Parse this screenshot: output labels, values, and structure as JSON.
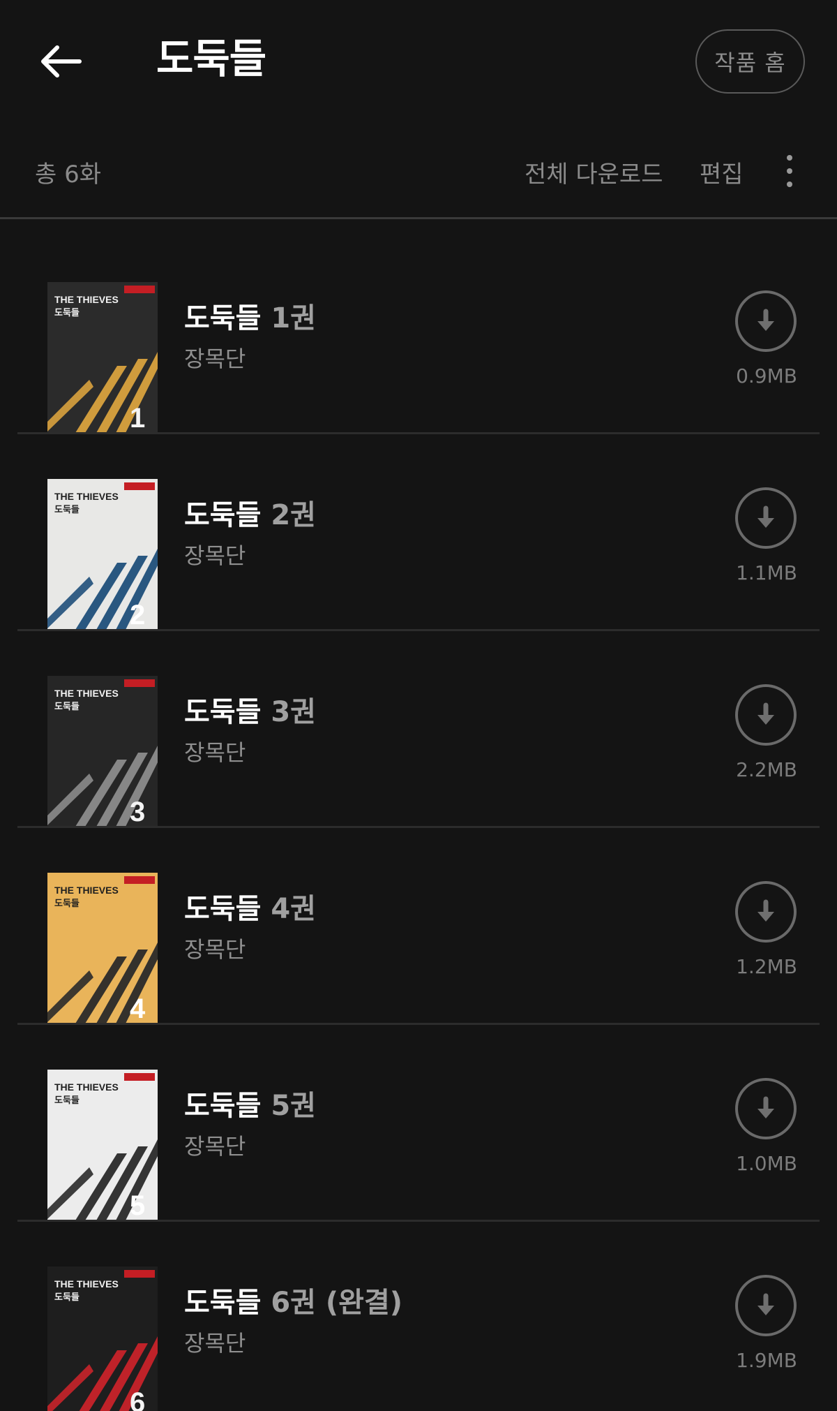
{
  "header": {
    "title": "도둑들",
    "home_button": "작품 홈",
    "back_icon": "arrow-left-icon"
  },
  "toolbar": {
    "total_count": "총 6화",
    "download_all": "전체 다운로드",
    "edit": "편집",
    "more_icon": "more-vertical-icon"
  },
  "episodes": [
    {
      "series": "도둑들",
      "volume": "1권",
      "author": "장목단",
      "size": "0.9MB",
      "cover_bg": "#2b2b2b",
      "cover_accent": "#d9a23e",
      "cover_title": "THE THIEVES",
      "cover_subtitle": "도둑들",
      "cover_number": "1"
    },
    {
      "series": "도둑들",
      "volume": "2권",
      "author": "장목단",
      "size": "1.1MB",
      "cover_bg": "#e8e8e6",
      "cover_accent": "#1f4f7a",
      "cover_title": "THE THIEVES",
      "cover_subtitle": "도둑들",
      "cover_number": "2"
    },
    {
      "series": "도둑들",
      "volume": "3권",
      "author": "장목단",
      "size": "2.2MB",
      "cover_bg": "#262626",
      "cover_accent": "#8c8c8c",
      "cover_title": "THE THIEVES",
      "cover_subtitle": "도둑들",
      "cover_number": "3"
    },
    {
      "series": "도둑들",
      "volume": "4권",
      "author": "장목단",
      "size": "1.2MB",
      "cover_bg": "#e9b45a",
      "cover_accent": "#2a2a2a",
      "cover_title": "THE THIEVES",
      "cover_subtitle": "도둑들",
      "cover_number": "4"
    },
    {
      "series": "도둑들",
      "volume": "5권",
      "author": "장목단",
      "size": "1.0MB",
      "cover_bg": "#ececec",
      "cover_accent": "#2a2a2a",
      "cover_title": "THE THIEVES",
      "cover_subtitle": "도둑들",
      "cover_number": "5"
    },
    {
      "series": "도둑들",
      "volume": "6권 (완결)",
      "author": "장목단",
      "size": "1.9MB",
      "cover_bg": "#1e1e1e",
      "cover_accent": "#c8232a",
      "cover_title": "THE THIEVES",
      "cover_subtitle": "도둑들",
      "cover_number": "6"
    }
  ],
  "colors": {
    "background": "#141414",
    "text_primary": "#ffffff",
    "text_secondary": "#8a8a8a",
    "divider": "#2c2c2c"
  }
}
